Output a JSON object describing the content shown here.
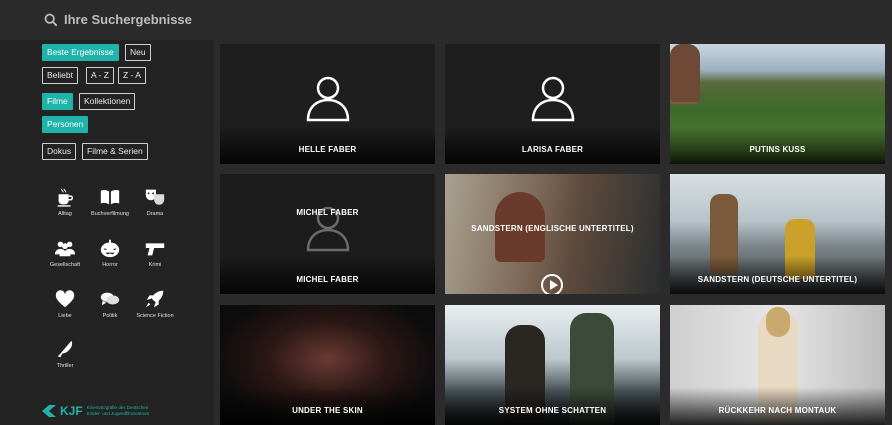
{
  "header": {
    "search_label": "Ihre Suchergebnisse"
  },
  "filters": {
    "sort_top": [
      "Beste Ergebnisse",
      "Neu"
    ],
    "sort_mid": [
      "Beliebt",
      "A - Z",
      "Z - A"
    ],
    "type_row1": [
      "Filme",
      "Kollektionen"
    ],
    "type_row2": [
      "Personen"
    ],
    "genre_row": [
      "Dokus",
      "Filme & Serien"
    ],
    "active_color": "#1fb3a9"
  },
  "categories": [
    {
      "label": "Alltag",
      "icon": "coffee-cup-icon"
    },
    {
      "label": "Buchverfilmung",
      "icon": "open-book-icon"
    },
    {
      "label": "Drama",
      "icon": "theater-masks-icon"
    },
    {
      "label": "Gesellschaft",
      "icon": "group-icon"
    },
    {
      "label": "Horror",
      "icon": "pumpkin-icon"
    },
    {
      "label": "Krimi",
      "icon": "gun-icon"
    },
    {
      "label": "Liebe",
      "icon": "heart-icon"
    },
    {
      "label": "Politik",
      "icon": "speech-bubbles-icon"
    },
    {
      "label": "Science Fiction",
      "icon": "rocket-icon"
    },
    {
      "label": "Thriller",
      "icon": "knife-icon"
    }
  ],
  "logo": {
    "mark": "KJF",
    "text": "Kinematografie des Deutschen Kinder- und Jugendfilmzentrum"
  },
  "results": [
    {
      "title": "HELLE FABER",
      "kind": "person"
    },
    {
      "title": "LARISA FABER",
      "kind": "person"
    },
    {
      "title": "PUTINS KUSS",
      "kind": "film"
    },
    {
      "title": "MICHEL FABER",
      "kind": "person",
      "overlay_title": "MICHEL FABER"
    },
    {
      "title": "SANDSTERN (ENGLISCHE UNTERTITEL)",
      "kind": "film"
    },
    {
      "title": "SANDSTERN (DEUTSCHE UNTERTITEL)",
      "kind": "film"
    },
    {
      "title": "UNDER THE SKIN",
      "kind": "film"
    },
    {
      "title": "SYSTEM OHNE SCHATTEN",
      "kind": "film"
    },
    {
      "title": "RÜCKKEHR NACH MONTAUK",
      "kind": "film"
    }
  ]
}
